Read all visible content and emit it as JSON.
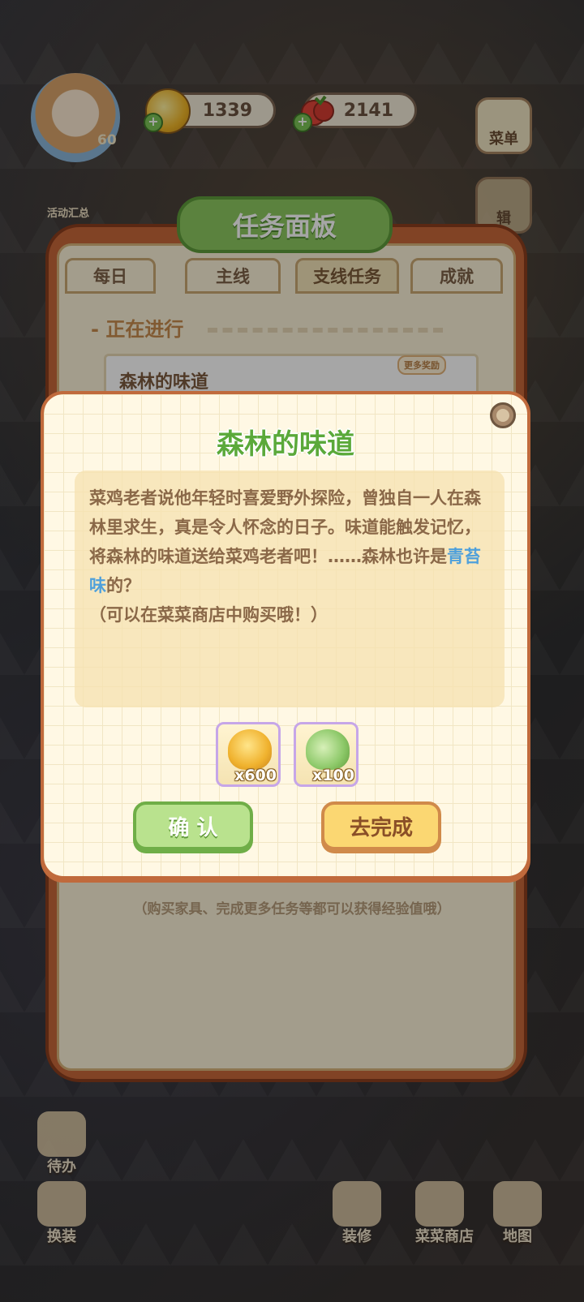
{
  "hud": {
    "level": "60",
    "coins": "1339",
    "veggies": "2141",
    "menu_label": "菜单",
    "events_label": "活动汇总",
    "edit_label_partial": "辑"
  },
  "panel": {
    "title": "任务面板",
    "tabs": [
      "每日",
      "主线",
      "支线任务",
      "成就"
    ],
    "active_tab": "支线任务",
    "section": "- 正在进行",
    "task_name": "森林的味道",
    "more_badge": "更多奖励",
    "footer": "（购买家具、完成更多任务等都可以获得经验值哦）"
  },
  "bottom_nav": {
    "todo": "待办",
    "dress": "换装",
    "decorate": "装修",
    "shop": "菜菜商店",
    "map": "地图"
  },
  "popup": {
    "title": "森林的味道",
    "desc_before": "菜鸡老者说他年轻时喜爱野外探险，曾独自一人在森林里求生，真是令人怀念的日子。味道能触发记忆，将森林的味道送给菜鸡老者吧！……森林也许是",
    "desc_highlight": "青苔味",
    "desc_after": "的？",
    "desc_note": "（可以在菜菜商店中购买哦！）",
    "rewards": [
      {
        "icon": "gold-coin-pile-icon",
        "count": "x600"
      },
      {
        "icon": "veggie-exp-up-icon",
        "count": "x100"
      }
    ],
    "confirm_label": "确 认",
    "go_label": "去完成"
  },
  "colors": {
    "title_green": "#5ba93a",
    "highlight_blue": "#4fa0db",
    "panel_orange": "#c7673a"
  }
}
